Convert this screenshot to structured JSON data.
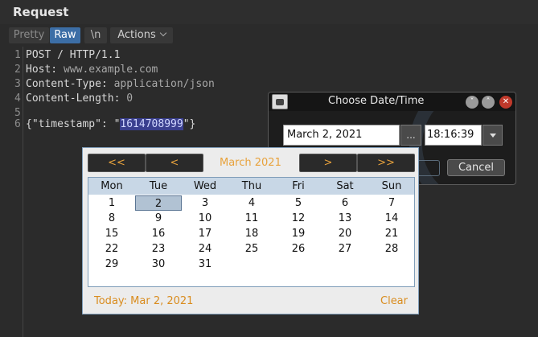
{
  "panel": {
    "title": "Request",
    "tabs": {
      "pretty": "Pretty",
      "raw": "Raw",
      "newline": "\\n",
      "actions": "Actions"
    }
  },
  "editor": {
    "lines": [
      {
        "num": "1",
        "text": "POST / HTTP/1.1"
      },
      {
        "num": "2",
        "key": "Host:",
        "value": " www.example.com"
      },
      {
        "num": "3",
        "key": "Content-Type:",
        "value": " application/json"
      },
      {
        "num": "4",
        "key": "Content-Length:",
        "value": " 0"
      },
      {
        "num": "5",
        "text": ""
      },
      {
        "num": "6",
        "before": "{\"timestamp\": \"",
        "selected": "1614708999",
        "after": "\"}"
      }
    ]
  },
  "dialog": {
    "title": "Choose Date/Time",
    "date_value": "March 2, 2021",
    "dots_label": "...",
    "time_value": "18:16:39",
    "cancel_label": "Cancel",
    "window_buttons": {
      "minimize": "˅",
      "maximize": "˄",
      "close": "✕"
    }
  },
  "calendar": {
    "nav": {
      "prev_year": "<<",
      "prev_month": "<",
      "next_month": ">",
      "next_year": ">>"
    },
    "month_label": "March  2021",
    "weekdays": [
      "Mon",
      "Tue",
      "Wed",
      "Thu",
      "Fri",
      "Sat",
      "Sun"
    ],
    "weeks": [
      [
        "1",
        "2",
        "3",
        "4",
        "5",
        "6",
        "7"
      ],
      [
        "8",
        "9",
        "10",
        "11",
        "12",
        "13",
        "14"
      ],
      [
        "15",
        "16",
        "17",
        "18",
        "19",
        "20",
        "21"
      ],
      [
        "22",
        "23",
        "24",
        "25",
        "26",
        "27",
        "28"
      ],
      [
        "29",
        "30",
        "31",
        "",
        "",
        "",
        ""
      ]
    ],
    "selected_day": "2",
    "today_label": "Today:  Mar 2, 2021",
    "clear_label": "Clear",
    "accent_color": "#e8a23c"
  }
}
